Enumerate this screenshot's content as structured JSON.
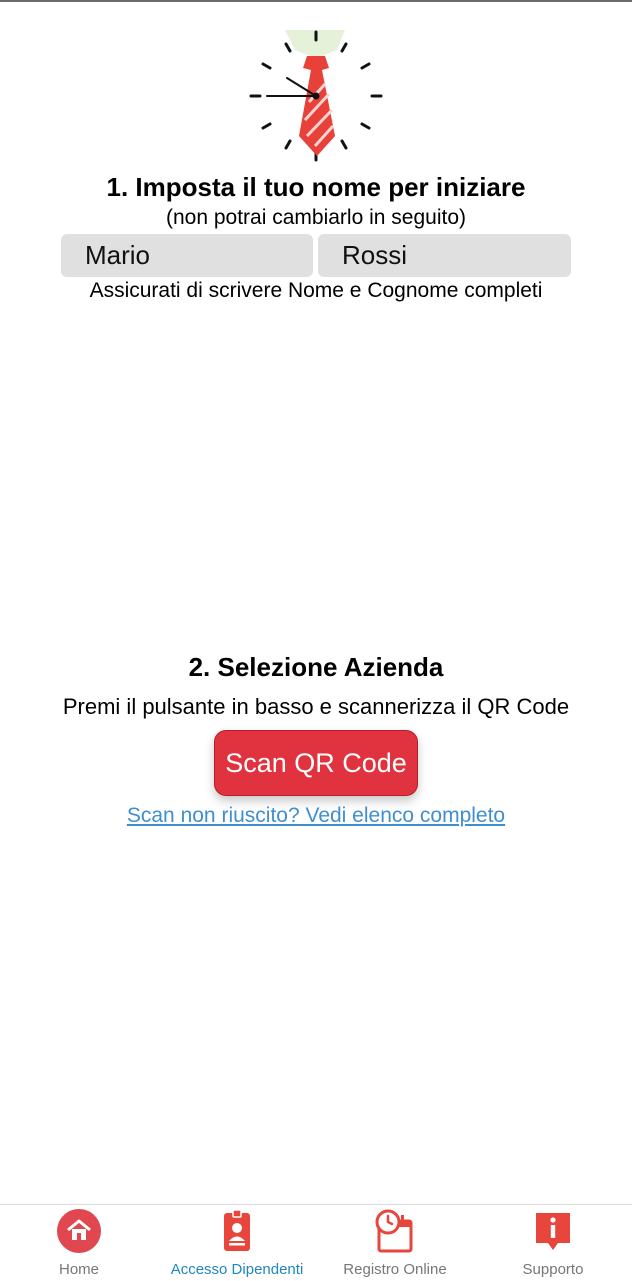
{
  "step1": {
    "title": "1. Imposta il tuo nome per iniziare",
    "subtitle": "(non potrai cambiarlo in seguito)",
    "first_name_value": "Mario",
    "last_name_value": "Rossi",
    "hint": "Assicurati di scrivere Nome e Cognome completi"
  },
  "step2": {
    "title": "2. Selezione Azienda",
    "subtitle": "Premi il pulsante in basso e scannerizza il QR Code",
    "scan_button_label": "Scan QR Code",
    "fallback_link": "Scan non riuscito? Vedi elenco completo"
  },
  "nav": {
    "items": [
      {
        "label": "Home",
        "icon": "home-icon",
        "active": false
      },
      {
        "label": "Accesso Dipendenti",
        "icon": "badge-icon",
        "active": true
      },
      {
        "label": "Registro Online",
        "icon": "calendar-clock-icon",
        "active": false
      },
      {
        "label": "Supporto",
        "icon": "info-icon",
        "active": false
      }
    ]
  },
  "colors": {
    "accent_red": "#e1323f",
    "link_blue": "#3f8fd0",
    "active_nav": "#1f86c0",
    "field_bg": "#e0e0e0"
  }
}
